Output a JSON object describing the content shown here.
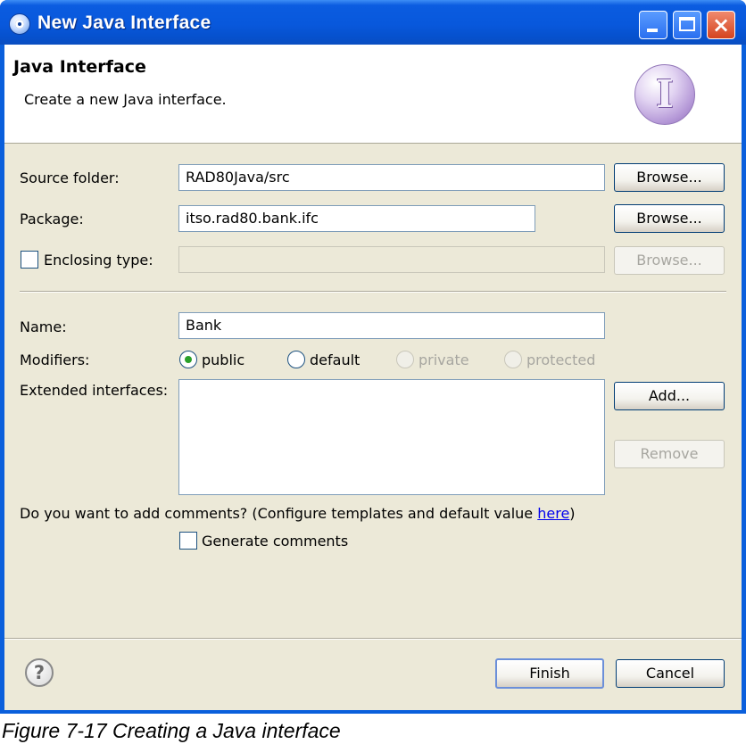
{
  "window": {
    "title": "New Java Interface",
    "close_glyph": "×"
  },
  "banner": {
    "title": "Java Interface",
    "description": "Create a new Java interface.",
    "icon_glyph": "I"
  },
  "form": {
    "source_folder": {
      "label": "Source folder:",
      "value": "RAD80Java/src",
      "browse_label": "Browse..."
    },
    "package": {
      "label": "Package:",
      "value": "itso.rad80.bank.ifc",
      "browse_label": "Browse..."
    },
    "enclosing_type": {
      "label": "Enclosing type:",
      "value": "",
      "checked": false,
      "browse_label": "Browse..."
    },
    "name": {
      "label": "Name:",
      "value": "Bank"
    },
    "modifiers": {
      "label": "Modifiers:",
      "options": [
        {
          "label": "public",
          "selected": true,
          "enabled": true
        },
        {
          "label": "default",
          "selected": false,
          "enabled": true
        },
        {
          "label": "private",
          "selected": false,
          "enabled": false
        },
        {
          "label": "protected",
          "selected": false,
          "enabled": false
        }
      ]
    },
    "extended_interfaces": {
      "label": "Extended interfaces:",
      "add_label": "Add...",
      "remove_label": "Remove",
      "items": []
    },
    "comments": {
      "question_prefix": "Do you want to add comments? (Configure templates and default value ",
      "link_text": "here",
      "question_suffix": ")",
      "generate_label": "Generate comments",
      "generate_checked": false
    }
  },
  "footer": {
    "help_glyph": "?",
    "finish_label": "Finish",
    "cancel_label": "Cancel"
  },
  "caption": {
    "text": "Figure 7-17   Creating a Java interface"
  }
}
